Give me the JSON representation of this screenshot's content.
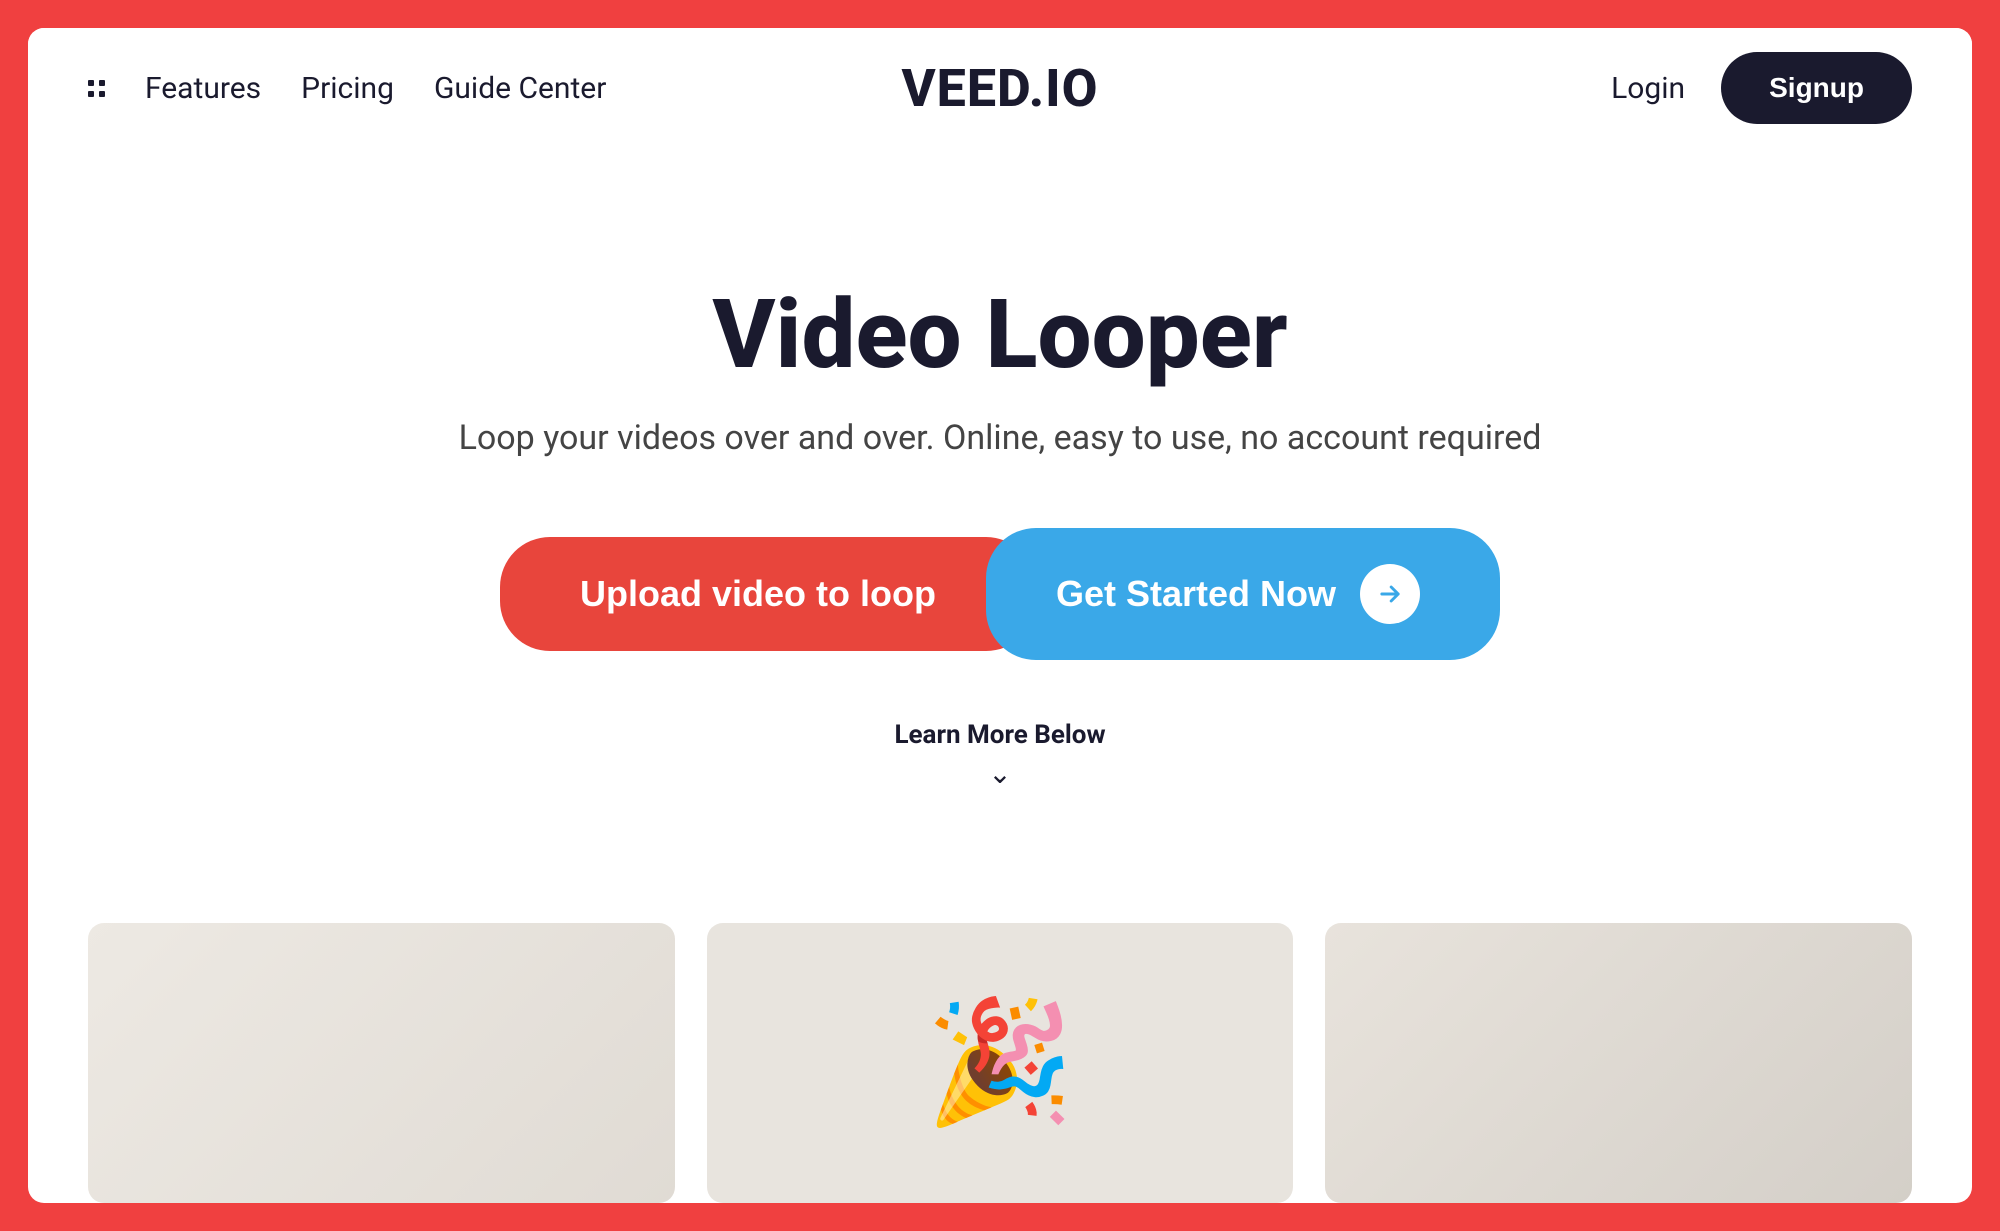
{
  "colors": {
    "bg_red": "#f04040",
    "dark_navy": "#1a1a2e",
    "white": "#ffffff",
    "upload_red": "#e8453c",
    "cta_blue": "#3aa8e8",
    "text_gray": "#444444"
  },
  "navbar": {
    "features_label": "Features",
    "pricing_label": "Pricing",
    "guide_center_label": "Guide Center",
    "brand_logo": "VEED.IO",
    "login_label": "Login",
    "signup_label": "Signup"
  },
  "hero": {
    "title": "Video Looper",
    "subtitle": "Loop your videos over and over. Online, easy to use, no account required",
    "upload_button_label": "Upload video to loop",
    "get_started_label": "Get Started Now",
    "learn_more_label": "Learn More Below"
  },
  "bottom_preview": {
    "items": [
      {
        "id": "left",
        "type": "placeholder"
      },
      {
        "id": "center",
        "type": "emoji"
      },
      {
        "id": "right",
        "type": "placeholder"
      }
    ]
  }
}
